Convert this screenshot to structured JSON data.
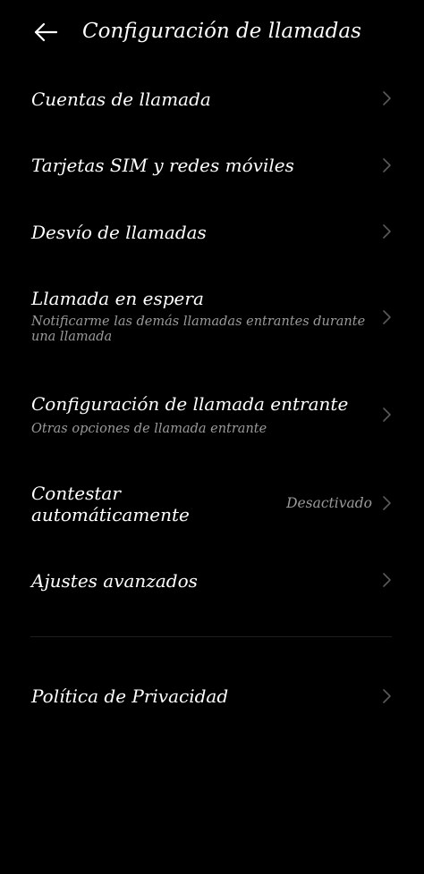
{
  "header": {
    "title": "Configuración de llamadas",
    "back_icon": "arrow-left-icon"
  },
  "colors": {
    "background": "#000000",
    "text_primary": "#ffffff",
    "text_secondary": "#9a9a9a",
    "chevron": "#5a5a5a",
    "divider": "#1e1e1e"
  },
  "menu": {
    "items": [
      {
        "label": "Cuentas de llamada"
      },
      {
        "label": "Tarjetas SIM y redes móviles"
      },
      {
        "label": "Desvío de llamadas"
      },
      {
        "label": "Llamada en espera",
        "subtitle": "Notificarme las demás llamadas entrantes durante una llamada"
      },
      {
        "label": "Configuración de llamada entrante",
        "subtitle": "Otras opciones de llamada entrante"
      },
      {
        "label": "Contestar automáticamente",
        "value": "Desactivado"
      },
      {
        "label": "Ajustes avanzados"
      },
      {
        "label": "Política de Privacidad"
      }
    ]
  }
}
